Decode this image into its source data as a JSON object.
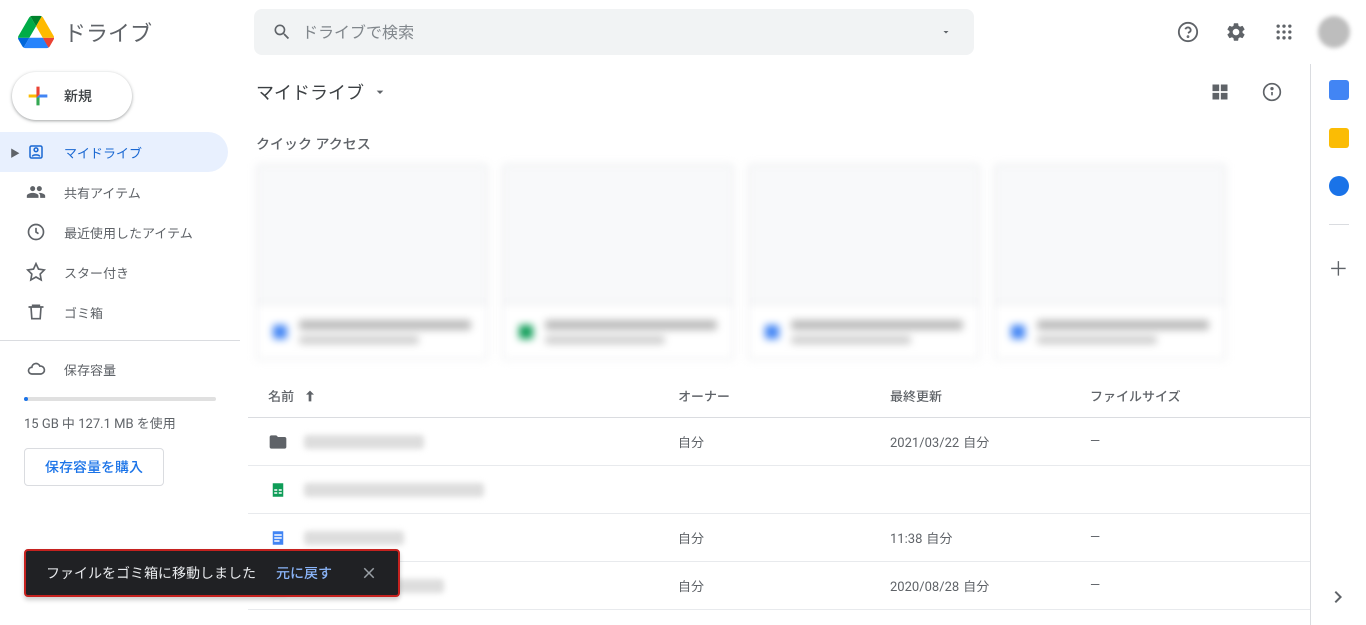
{
  "header": {
    "product_name": "ドライブ",
    "search_placeholder": "ドライブで検索"
  },
  "sidebar": {
    "new_label": "新規",
    "items": [
      {
        "label": "マイドライブ"
      },
      {
        "label": "共有アイテム"
      },
      {
        "label": "最近使用したアイテム"
      },
      {
        "label": "スター付き"
      },
      {
        "label": "ゴミ箱"
      }
    ],
    "storage_label": "保存容量",
    "storage_text": "15 GB 中 127.1 MB を使用",
    "buy_label": "保存容量を購入"
  },
  "content": {
    "breadcrumb": "マイドライブ",
    "quick_title": "クイック アクセス",
    "table": {
      "headers": {
        "name": "名前",
        "owner": "オーナー",
        "modified": "最終更新",
        "size": "ファイルサイズ"
      },
      "rows": [
        {
          "type": "folder",
          "owner": "自分",
          "modified_date": "2021/03/22",
          "modified_by": "自分",
          "size": "—"
        },
        {
          "type": "sheets",
          "owner": "",
          "modified_date": "",
          "modified_by": "",
          "size": ""
        },
        {
          "type": "docs",
          "owner": "自分",
          "modified_date": "11:38",
          "modified_by": "自分",
          "size": "—"
        },
        {
          "type": "unknown",
          "owner": "自分",
          "modified_date": "2020/08/28",
          "modified_by": "自分",
          "size": "—"
        }
      ]
    }
  },
  "toast": {
    "message": "ファイルをゴミ箱に移動しました",
    "action": "元に戻す"
  }
}
